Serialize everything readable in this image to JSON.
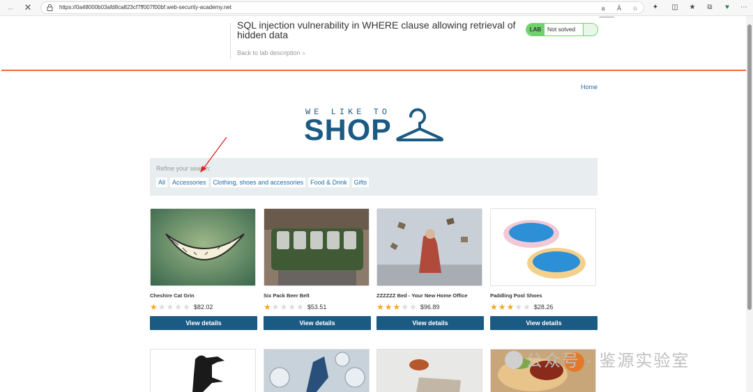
{
  "browser": {
    "url": "https://0a48000b03afd8ca823cf7ff007f00bf.web-security-academy.net",
    "icons": [
      "back-arrow-icon",
      "close-icon",
      "lock-icon",
      "read-aloud-icon",
      "text-size-icon",
      "favorite-star-icon",
      "extensions-icon",
      "split-screen-icon",
      "favorites-icon",
      "collections-icon",
      "browser-essentials-icon",
      "more-menu-icon"
    ]
  },
  "lab": {
    "title": "SQL injection vulnerability in WHERE clause allowing retrieval of hidden data",
    "back_link": "Back to lab description",
    "badge": "LAB",
    "status": "Not solved",
    "accent": "#70d16d"
  },
  "site": {
    "home_link": "Home",
    "logo_small": "WE LIKE TO",
    "logo_big": "SHOP",
    "brand_color": "#1b5a83",
    "accent_line": "#ff6633"
  },
  "filter": {
    "label": "Refine your search:",
    "categories": [
      "All",
      "Accessories",
      "Clothing, shoes and accessories",
      "Food & Drink",
      "Gifts"
    ]
  },
  "products": [
    {
      "name": "Cheshire Cat Grin",
      "stars": 1,
      "price": "$82.02",
      "button": "View details"
    },
    {
      "name": "Six Pack Beer Belt",
      "stars": 1,
      "price": "$53.51",
      "button": "View details"
    },
    {
      "name": "ZZZZZZ Bed - Your New Home Office",
      "stars": 3,
      "price": "$96.89",
      "button": "View details"
    },
    {
      "name": "Paddling Pool Shoes",
      "stars": 3,
      "price": "$28.26",
      "button": "View details"
    }
  ],
  "watermark": "公众号 · 鉴源实验室"
}
